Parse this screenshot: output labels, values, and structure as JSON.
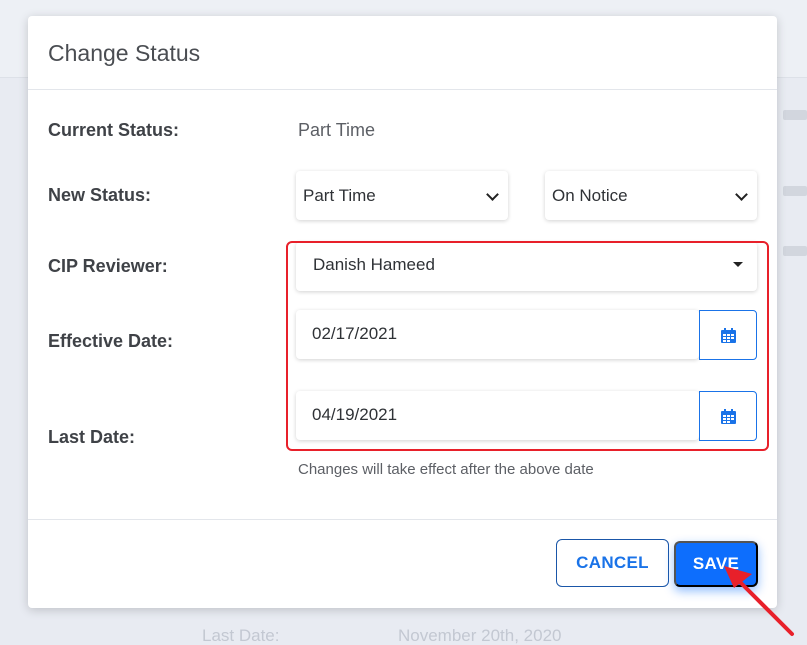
{
  "modal": {
    "title": "Change Status",
    "fields": {
      "current_status_label": "Current Status:",
      "current_status_value": "Part Time",
      "new_status_label": "New Status:",
      "new_status_primary": "Part Time",
      "new_status_secondary": "On Notice",
      "cip_reviewer_label": "CIP Reviewer:",
      "cip_reviewer_value": "Danish Hameed",
      "effective_date_label": "Effective Date:",
      "effective_date_value": "02/17/2021",
      "last_date_label": "Last Date:",
      "last_date_value": "04/19/2021",
      "help_text": "Changes will take effect after the above date"
    },
    "footer": {
      "cancel_label": "CANCEL",
      "save_label": "SAVE"
    }
  },
  "background": {
    "last_date_label": "Last Date:",
    "last_date_value": "November 20th, 2020"
  },
  "colors": {
    "accent": "#0d6efd",
    "highlight": "#e8202a",
    "arrow": "#e8202a"
  },
  "icons": {
    "calendar": "calendar-icon",
    "dropdown": "chevron-down-icon",
    "caret": "caret-down-icon"
  }
}
